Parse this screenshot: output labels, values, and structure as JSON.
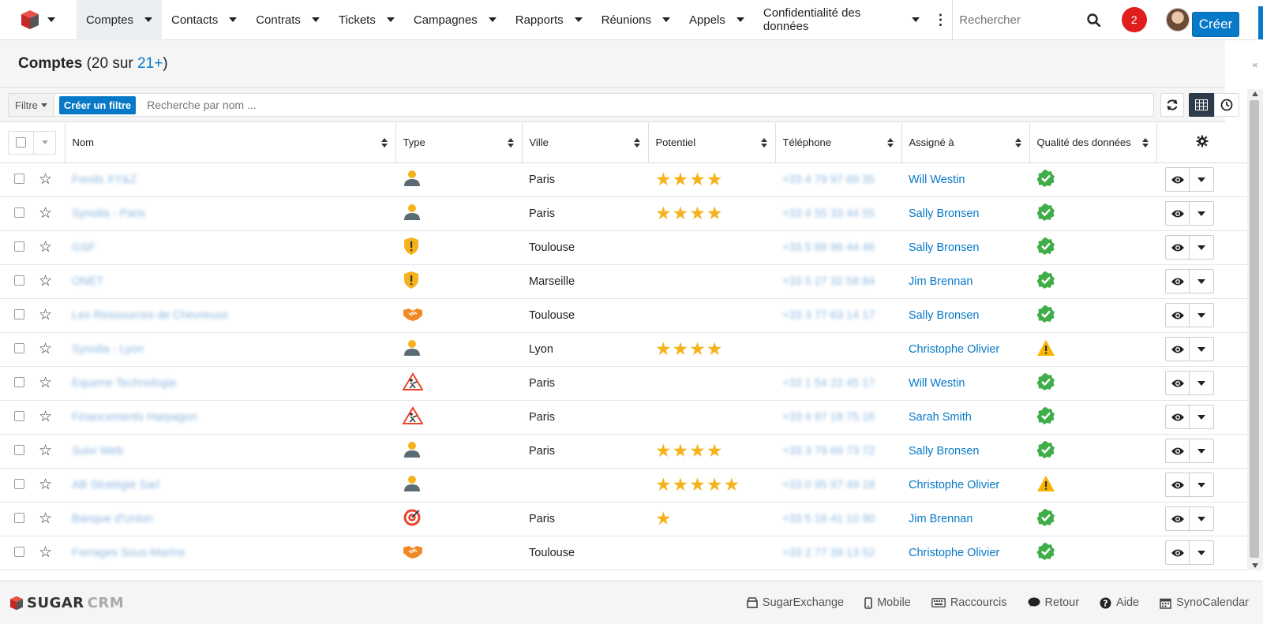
{
  "nav": {
    "items": [
      {
        "label": "Comptes",
        "active": true
      },
      {
        "label": "Contacts"
      },
      {
        "label": "Contrats"
      },
      {
        "label": "Tickets"
      },
      {
        "label": "Campagnes"
      },
      {
        "label": "Rapports"
      },
      {
        "label": "Réunions"
      },
      {
        "label": "Appels"
      },
      {
        "label": "Confidentialité des données"
      }
    ],
    "search_placeholder": "Rechercher",
    "notification_count": "2"
  },
  "header": {
    "title": "Comptes",
    "count_prefix": " (20 sur ",
    "count_more": "21+",
    "count_suffix": ")",
    "create_label": "Créer"
  },
  "filter": {
    "dropdown_label": "Filtre",
    "create_filter_label": "Créer un filtre",
    "search_placeholder": "Recherche par nom ..."
  },
  "table": {
    "columns": [
      "Nom",
      "Type",
      "Ville",
      "Potentiel",
      "Téléphone",
      "Assigné à",
      "Qualité des données"
    ],
    "rows": [
      {
        "name": "Fonds XY&Z",
        "type": "person",
        "city": "Paris",
        "rating": 4,
        "phone": "+33 4 79 97 69 35",
        "assigned": "Will Westin",
        "quality": "ok"
      },
      {
        "name": "Synolia - Paris",
        "type": "person",
        "city": "Paris",
        "rating": 4,
        "phone": "+33 4 55 33 44 55",
        "assigned": "Sally Bronsen",
        "quality": "ok"
      },
      {
        "name": "GSF",
        "type": "shield",
        "city": "Toulouse",
        "rating": 0,
        "phone": "+33 5 99 96 44 46",
        "assigned": "Sally Bronsen",
        "quality": "ok"
      },
      {
        "name": "ONET",
        "type": "shield",
        "city": "Marseille",
        "rating": 0,
        "phone": "+33 5 27 32 58 84",
        "assigned": "Jim Brennan",
        "quality": "ok"
      },
      {
        "name": "Les Ressources de Chevreuse",
        "type": "handshake",
        "city": "Toulouse",
        "rating": 0,
        "phone": "+33 3 77 63 14 17",
        "assigned": "Sally Bronsen",
        "quality": "ok"
      },
      {
        "name": "Synolia - Lyon",
        "type": "person",
        "city": "Lyon",
        "rating": 4,
        "phone": "",
        "assigned": "Christophe Olivier",
        "quality": "warn"
      },
      {
        "name": "Equerre Technologie",
        "type": "construction",
        "city": "Paris",
        "rating": 0,
        "phone": "+33 1 54 22 45 17",
        "assigned": "Will Westin",
        "quality": "ok"
      },
      {
        "name": "Financements Harpagon",
        "type": "construction",
        "city": "Paris",
        "rating": 0,
        "phone": "+33 4 97 18 75 16",
        "assigned": "Sarah Smith",
        "quality": "ok"
      },
      {
        "name": "Suivi Web",
        "type": "person",
        "city": "Paris",
        "rating": 4,
        "phone": "+33 3 79 69 73 72",
        "assigned": "Sally Bronsen",
        "quality": "ok"
      },
      {
        "name": "AB Stratégie Sarl",
        "type": "person",
        "city": "",
        "rating": 5,
        "phone": "+33 0 95 97 49 18",
        "assigned": "Christophe Olivier",
        "quality": "warn"
      },
      {
        "name": "Banque d'Union",
        "type": "target",
        "city": "Paris",
        "rating": 1,
        "phone": "+33 5 16 41 10 90",
        "assigned": "Jim Brennan",
        "quality": "ok"
      },
      {
        "name": "Forrages Sous-Marins",
        "type": "handshake",
        "city": "Toulouse",
        "rating": 0,
        "phone": "+33 2 77 39 13 52",
        "assigned": "Christophe Olivier",
        "quality": "ok"
      }
    ]
  },
  "footer": {
    "logo_main": "SUGAR",
    "logo_accent": "CRM",
    "links": [
      {
        "label": "SugarExchange",
        "icon": "exchange-icon"
      },
      {
        "label": "Mobile",
        "icon": "mobile-icon"
      },
      {
        "label": "Raccourcis",
        "icon": "keyboard-icon"
      },
      {
        "label": "Retour",
        "icon": "comment-icon"
      },
      {
        "label": "Aide",
        "icon": "help-icon"
      },
      {
        "label": "SynoCalendar",
        "icon": "calendar-icon"
      }
    ]
  },
  "colors": {
    "accent": "#0679c8",
    "star": "#f6b21c",
    "ok": "#3fae49",
    "warn": "#f7b500",
    "notification": "#e01e1e"
  }
}
